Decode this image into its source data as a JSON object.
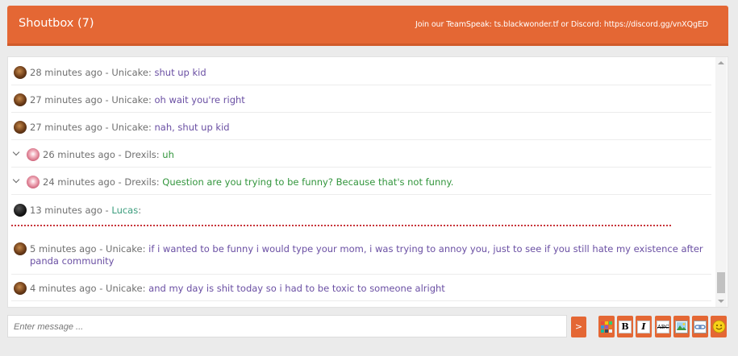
{
  "header": {
    "title": "Shoutbox (7)",
    "notice": "Join our TeamSpeak: ts.blackwonder.tf or Discord: https://discord.gg/vnXQgED"
  },
  "messages": [
    {
      "time": "28 minutes ago",
      "user": "Unicake",
      "text": "shut up kid",
      "avatar": "avatar-unicake-icon",
      "text_color": "purple"
    },
    {
      "time": "27 minutes ago",
      "user": "Unicake",
      "text": "oh wait you're right",
      "avatar": "avatar-unicake-icon",
      "text_color": "purple"
    },
    {
      "time": "27 minutes ago",
      "user": "Unicake",
      "text": "nah, shut up kid",
      "avatar": "avatar-unicake-icon",
      "text_color": "purple"
    },
    {
      "time": "26 minutes ago",
      "user": "Drexils",
      "text": "uh",
      "avatar": "avatar-drexils-icon",
      "text_color": "green"
    },
    {
      "time": "24 minutes ago",
      "user": "Drexils",
      "text": "Question are you trying to be funny? Because that's not funny.",
      "avatar": "avatar-drexils-icon",
      "text_color": "green"
    },
    {
      "time": "13 minutes ago",
      "user": "Lucas",
      "text": "",
      "avatar": "avatar-lucas-icon",
      "text_color": "teal"
    },
    {
      "time": "5 minutes ago",
      "user": "Unicake",
      "text": "if i wanted to be funny i would type your mom, i was trying to annoy you, just to see if you still hate my existence after panda community",
      "avatar": "avatar-unicake-icon",
      "text_color": "purple"
    },
    {
      "time": "4 minutes ago",
      "user": "Unicake",
      "text": "and my day is shit today so i had to be toxic to someone alright",
      "avatar": "avatar-unicake-icon",
      "text_color": "purple"
    }
  ],
  "separator": " - ",
  "colon": ":",
  "composer": {
    "placeholder": "Enter message ...",
    "send_label": ">"
  },
  "toolbar": {
    "bold_label": "B",
    "italic_label": "I",
    "strike_label": "ABC",
    "items": [
      "color-picker-icon",
      "bold-icon",
      "italic-icon",
      "strikethrough-icon",
      "image-icon",
      "link-icon",
      "smiley-icon"
    ]
  },
  "colors": {
    "accent": "#e46734",
    "purple_text": "#6a4fa3",
    "green_text": "#32953c",
    "teal_text": "#3a9c7c"
  }
}
